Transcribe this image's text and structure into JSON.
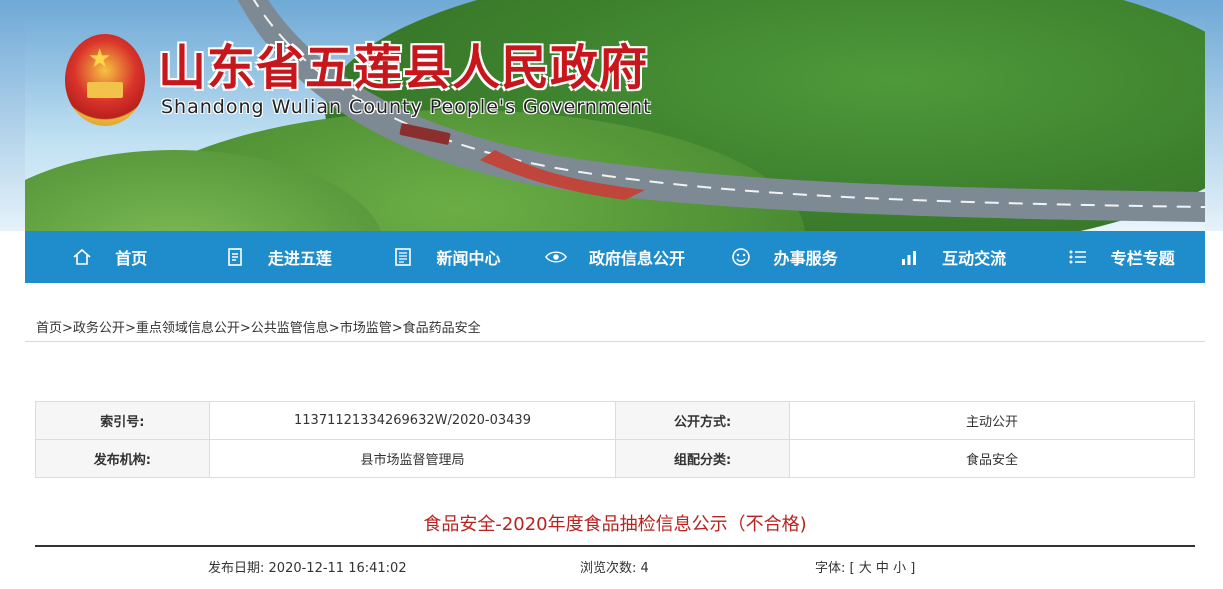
{
  "header": {
    "title_cn": "山东省五莲县人民政府",
    "title_en": "Shandong Wulian County People's Government"
  },
  "nav": [
    {
      "label": "首页",
      "icon": "home-icon"
    },
    {
      "label": "走进五莲",
      "icon": "document-icon"
    },
    {
      "label": "新闻中心",
      "icon": "news-icon"
    },
    {
      "label": "政府信息公开",
      "icon": "eye-icon"
    },
    {
      "label": "办事服务",
      "icon": "smile-icon"
    },
    {
      "label": "互动交流",
      "icon": "chart-icon"
    },
    {
      "label": "专栏专题",
      "icon": "list-icon"
    }
  ],
  "breadcrumb": {
    "items": [
      "首页",
      "政务公开",
      "重点领域信息公开",
      "公共监管信息",
      "市场监管",
      "食品药品安全"
    ],
    "separator": ">"
  },
  "meta": {
    "index_label": "索引号:",
    "index_value": "11371121334269632W/2020-03439",
    "method_label": "公开方式:",
    "method_value": "主动公开",
    "publisher_label": "发布机构:",
    "publisher_value": "县市场监督管理局",
    "category_label": "组配分类:",
    "category_value": "食品安全"
  },
  "article": {
    "title": "食品安全-2020年度食品抽检信息公示（不合格)",
    "date_label": "发布日期:",
    "date_value": "2020-12-11 16:41:02",
    "views_label": "浏览次数:",
    "views_value": "4",
    "font_label": "字体:",
    "font_open": "[",
    "font_large": "大",
    "font_medium": "中",
    "font_small": "小",
    "font_close": "]"
  },
  "colors": {
    "nav_bg": "#1f8ccc",
    "title_red": "#c8161d",
    "article_title": "#b8231f"
  }
}
